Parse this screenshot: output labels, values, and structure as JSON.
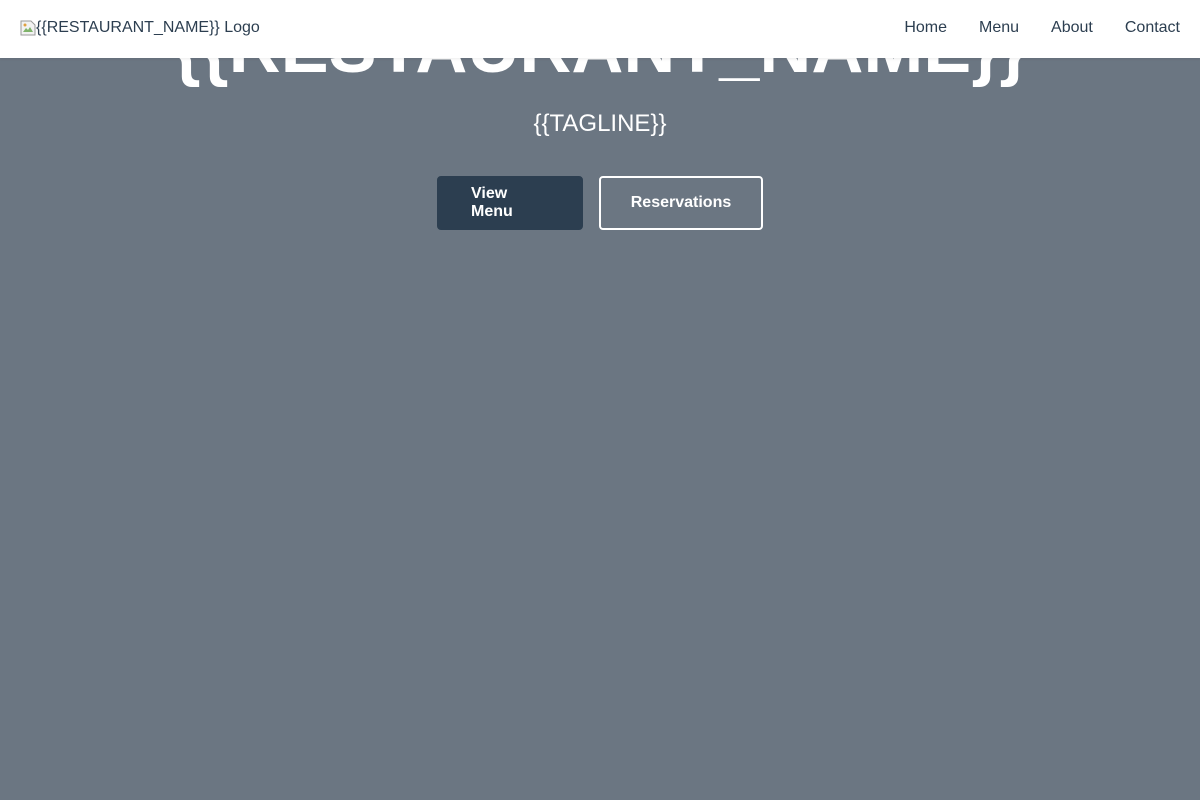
{
  "header": {
    "logo_alt": "{{RESTAURANT_NAME}} Logo",
    "logo_icon": "broken-image-icon",
    "nav": [
      {
        "label": "Home"
      },
      {
        "label": "Menu"
      },
      {
        "label": "About"
      },
      {
        "label": "Contact"
      }
    ]
  },
  "hero": {
    "title": "{{RESTAURANT_NAME}}",
    "tagline": "{{TAGLINE}}",
    "primary_button": "View Menu",
    "secondary_button": "Reservations"
  },
  "colors": {
    "hero_background": "#6b7682",
    "primary": "#2c3e50",
    "text_light": "#ffffff",
    "header_background": "#ffffff"
  }
}
